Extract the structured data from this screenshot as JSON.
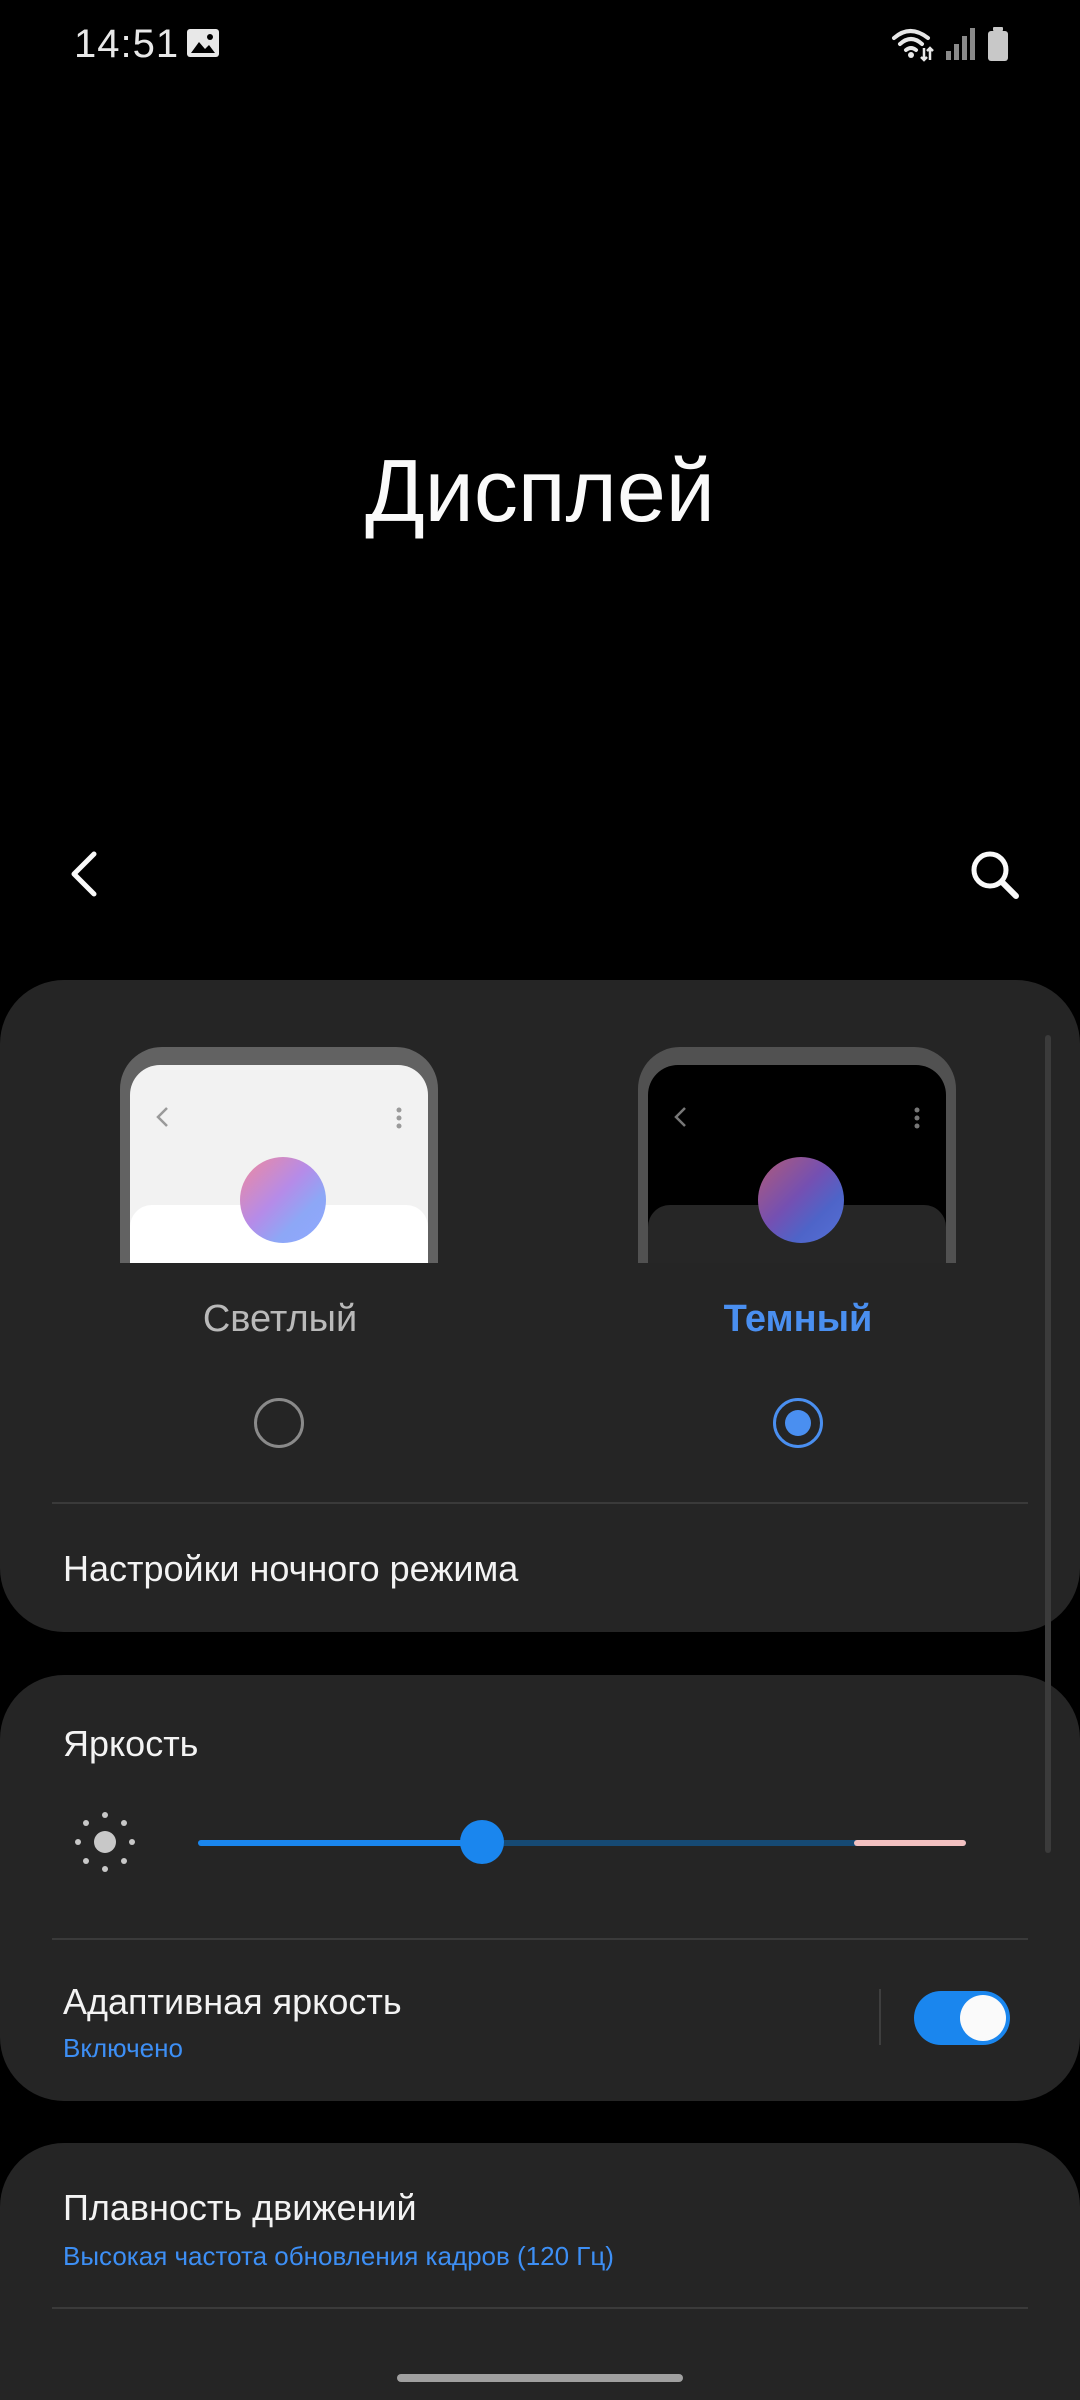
{
  "status_bar": {
    "time": "14:51",
    "icons": [
      "gallery-icon",
      "wifi-icon",
      "signal-icon",
      "battery-icon"
    ]
  },
  "header": {
    "title": "Дисплей",
    "back_icon": "chevron-left-icon",
    "search_icon": "search-icon"
  },
  "theme": {
    "options": [
      {
        "label": "Светлый",
        "selected": false
      },
      {
        "label": "Темный",
        "selected": true
      }
    ],
    "night_mode_settings": "Настройки ночного режима"
  },
  "brightness": {
    "title": "Яркость",
    "level": 0.37,
    "adaptive": {
      "title": "Адаптивная яркость",
      "status": "Включено",
      "enabled": true
    }
  },
  "motion": {
    "title": "Плавность движений",
    "subtitle": "Высокая частота обновления кадров (120 Гц)"
  },
  "colors": {
    "accent": "#3d8ff5",
    "card": "#252525",
    "background": "#000000"
  }
}
